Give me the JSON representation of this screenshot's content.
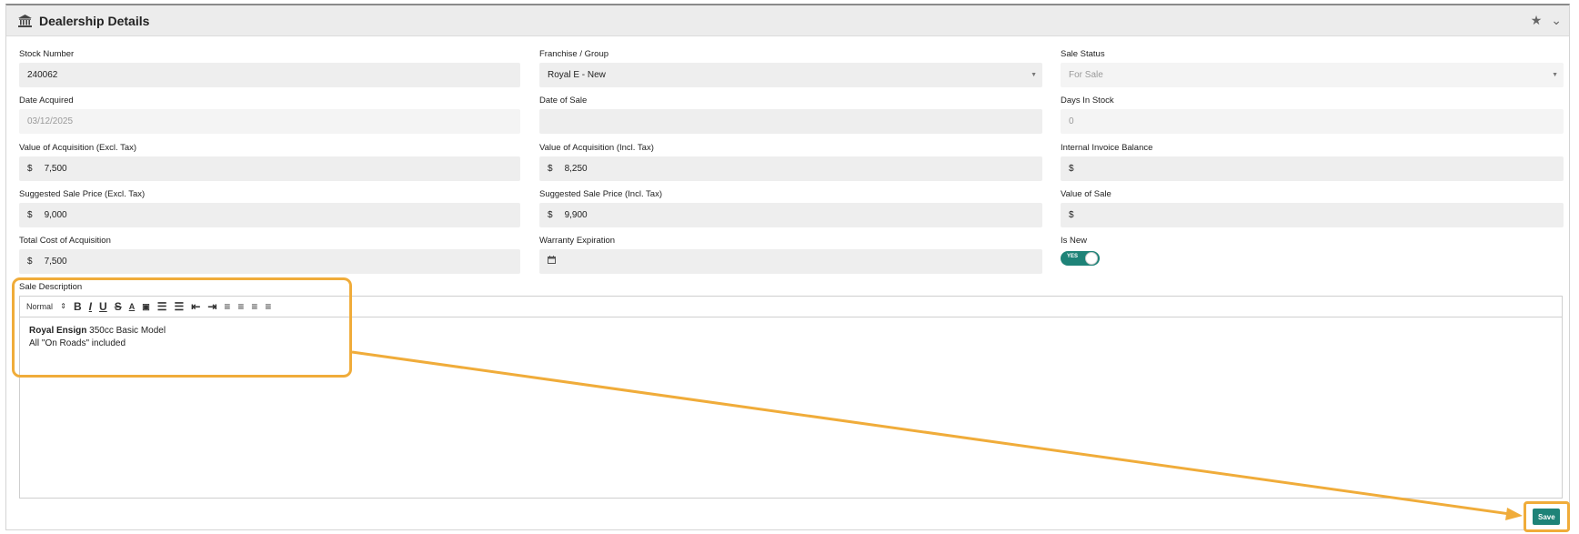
{
  "panel": {
    "title": "Dealership Details",
    "icons": {
      "header": "bank-icon",
      "favorite": "star-icon",
      "collapse": "chevron-down-icon"
    }
  },
  "fields": {
    "stock_number": {
      "label": "Stock Number",
      "value": "240062"
    },
    "franchise_group": {
      "label": "Franchise / Group",
      "value": "Royal E - New"
    },
    "sale_status": {
      "label": "Sale Status",
      "value": "For Sale"
    },
    "date_acquired": {
      "label": "Date Acquired",
      "value": "03/12/2025"
    },
    "date_of_sale": {
      "label": "Date of Sale",
      "value": ""
    },
    "days_in_stock": {
      "label": "Days In Stock",
      "value": "0"
    },
    "value_acq_excl": {
      "label": "Value of Acquisition (Excl. Tax)",
      "currency": "$",
      "value": "7,500"
    },
    "value_acq_incl": {
      "label": "Value of Acquisition (Incl. Tax)",
      "currency": "$",
      "value": "8,250"
    },
    "internal_invoice_balance": {
      "label": "Internal Invoice Balance",
      "currency": "$",
      "value": ""
    },
    "suggested_price_excl": {
      "label": "Suggested Sale Price (Excl. Tax)",
      "currency": "$",
      "value": "9,000"
    },
    "suggested_price_incl": {
      "label": "Suggested Sale Price (Incl. Tax)",
      "currency": "$",
      "value": "9,900"
    },
    "value_of_sale": {
      "label": "Value of Sale",
      "currency": "$",
      "value": ""
    },
    "total_cost_acq": {
      "label": "Total Cost of Acquisition",
      "currency": "$",
      "value": "7,500"
    },
    "warranty_expiration": {
      "label": "Warranty Expiration",
      "value": ""
    },
    "is_new": {
      "label": "Is New",
      "toggle_text": "YES",
      "on": true
    }
  },
  "sale_description": {
    "label": "Sale Description",
    "format_select": "Normal",
    "content_bold": "Royal Ensign",
    "content_rest": " 350cc Basic Model",
    "content_line2": "All \"On Roads\" included"
  },
  "actions": {
    "save_label": "Save"
  },
  "colors": {
    "accent": "#1e8378",
    "annotation": "#f0ac3a"
  }
}
